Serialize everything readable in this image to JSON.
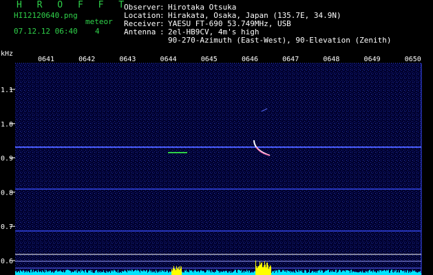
{
  "header": {
    "logo": "H R O F F T",
    "filename": "HI12120640.png",
    "meteor_label": "meteor",
    "meteor_count": "4",
    "datetime": "07.12.12 06:40"
  },
  "info": {
    "observer_label": "Observer",
    "observer": "Hirotaka Otsuka",
    "location_label": "Location",
    "location": "Hirakata, Osaka, Japan (135.7E, 34.9N)",
    "receiver_label": "Receiver",
    "receiver": "YAESU FT-690 53.749MHz, USB",
    "antenna_label": "Antenna",
    "antenna": "2el-HB9CV, 4m's high",
    "antenna_detail": "90-270-Azimuth (East-West), 90-Elevation (Zenith)"
  },
  "spectrogram": {
    "y_unit": "kHz",
    "time_ticks": [
      "0641",
      "0642",
      "0643",
      "0644",
      "0645",
      "0646",
      "0647",
      "0648",
      "0649",
      "0650"
    ],
    "freq_ticks": [
      "1.1",
      "1.0",
      "0.9",
      "0.8",
      "0.7",
      "0.6"
    ],
    "colors": {
      "background": "#00003a",
      "band": "#3a4dff",
      "trace": "#ffffff",
      "spectrum": "#00e5ff",
      "spectrum_peak": "#ffff00"
    }
  }
}
